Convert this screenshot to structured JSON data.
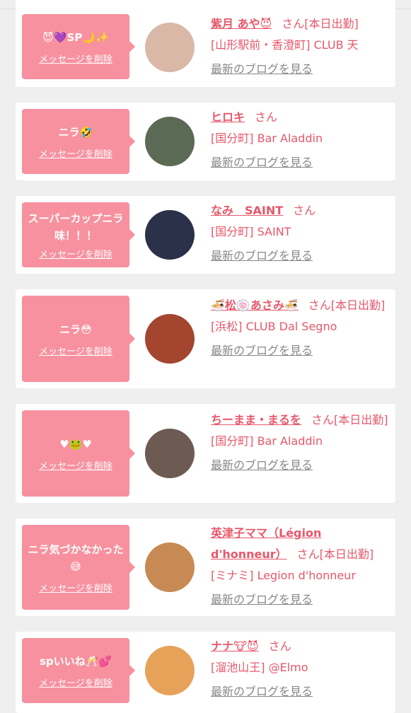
{
  "cards": [
    {
      "message": "😈💜SP🌙✨",
      "delete_label": "メッセージを削除",
      "name": "紫月 あや😈",
      "suffix": "さん",
      "status": "[本日出勤]",
      "shop": "[山形駅前・香澄町] CLUB 天",
      "blog": "最新のブログを見る",
      "avatar_color": "#d9b8a8"
    },
    {
      "message": "ニラ🤣",
      "delete_label": "メッセージを削除",
      "name": "ヒロキ",
      "suffix": "さん",
      "status": "",
      "shop": "[国分町] Bar Aladdin",
      "blog": "最新のブログを見る",
      "avatar_color": "#5b6a55"
    },
    {
      "message": "スーパーカップニラ味！！！",
      "delete_label": "メッセージを削除",
      "name": "なみ　SAINT",
      "suffix": "さん",
      "status": "",
      "shop": "[国分町] SAINT",
      "blog": "最新のブログを見る",
      "avatar_color": "#2b3148"
    },
    {
      "message": "ニラ😳",
      "delete_label": "メッセージを削除",
      "name": "🍜松🍥あさみ🍜",
      "suffix": "さん",
      "status": "[本日出勤]",
      "shop": "[浜松] CLUB Dal Segno",
      "blog": "最新のブログを見る",
      "avatar_color": "#a3452f"
    },
    {
      "message": "♥🐸♥",
      "delete_label": "メッセージを削除",
      "name": "ちーまま・まるを",
      "suffix": "さん",
      "status": "[本日出勤]",
      "shop": "[国分町] Bar Aladdin",
      "blog": "最新のブログを見る",
      "avatar_color": "#6d5a52"
    },
    {
      "message": "ニラ気づかなかった😅",
      "delete_label": "メッセージを削除",
      "name": "英津子ママ（Légion d'honneur）",
      "suffix": "さん",
      "status": "[本日出勤]",
      "shop": "[ミナミ] Legion d'honneur",
      "blog": "最新のブログを見る",
      "avatar_color": "#c88a54"
    },
    {
      "message": "spいいね🥂💕",
      "delete_label": "メッセージを削除",
      "name": "ナナ🐮😈",
      "suffix": "さん",
      "status": "",
      "shop": "[溜池山王] @Elmo",
      "blog": "最新のブログを見る",
      "avatar_color": "#e7a25a"
    }
  ]
}
